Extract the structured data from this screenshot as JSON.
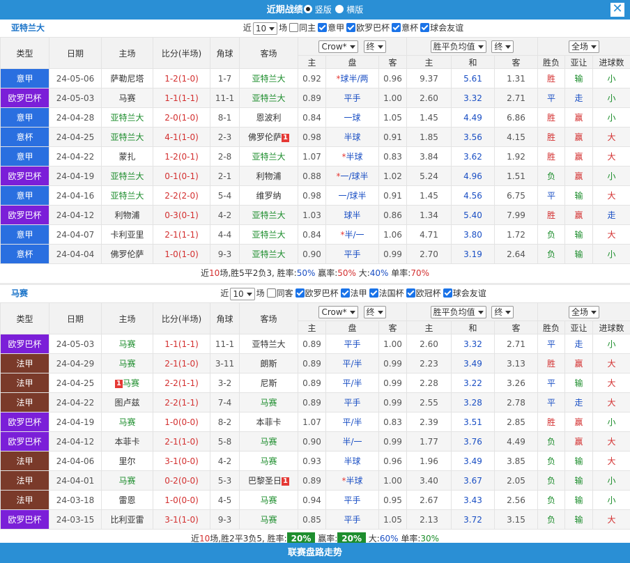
{
  "top": {
    "title": "近期战绩",
    "opt_vertical": "竖版",
    "opt_horizontal": "横版",
    "close": "✕"
  },
  "header_labels": {
    "type": "类型",
    "date": "日期",
    "home": "主场",
    "score": "比分(半场)",
    "corner": "角球",
    "away": "客场",
    "h_home": "主",
    "h_line": "盘",
    "h_away": "客",
    "o_home": "主",
    "o_draw": "和",
    "o_away": "客",
    "result": "胜负",
    "asian": "亚让",
    "goals": "进球数"
  },
  "sections": [
    {
      "team": "亚特兰大",
      "filter": {
        "near": "近",
        "count": "10",
        "unit": "场",
        "same": "同主",
        "leagues": [
          "意甲",
          "欧罗巴杯",
          "意杯",
          "球会友谊"
        ],
        "company": "Crow*",
        "phase1": "终",
        "oddtype": "胜平负均值",
        "phase2": "终",
        "half": "全场"
      },
      "rows": [
        {
          "type": "意甲",
          "tc": "ita",
          "date": "24-05-06",
          "home": "萨勒尼塔",
          "score": "1-2(1-0)",
          "corner": "1-7",
          "away": "亚特兰大",
          "hl": "away",
          "hh": "0.92",
          "hline": "*球半/两",
          "ha": "0.96",
          "oh": "9.37",
          "od": "5.61",
          "oa": "1.31",
          "res": "胜",
          "asian": "输",
          "goals": "小"
        },
        {
          "type": "欧罗巴杯",
          "tc": "cup",
          "date": "24-05-03",
          "home": "马赛",
          "score": "1-1(1-1)",
          "corner": "11-1",
          "away": "亚特兰大",
          "hl": "away",
          "hh": "0.89",
          "hline": "平手",
          "ha": "1.00",
          "oh": "2.60",
          "od": "3.32",
          "oa": "2.71",
          "res": "平",
          "asian": "走",
          "goals": "小"
        },
        {
          "type": "意甲",
          "tc": "ita",
          "date": "24-04-28",
          "home": "亚特兰大",
          "score": "2-0(1-0)",
          "corner": "8-1",
          "away": "恩波利",
          "hl": "home",
          "hh": "0.84",
          "hline": "一球",
          "ha": "1.05",
          "oh": "1.45",
          "od": "4.49",
          "oa": "6.86",
          "res": "胜",
          "asian": "赢",
          "goals": "小"
        },
        {
          "type": "意杯",
          "tc": "ita",
          "date": "24-04-25",
          "home": "亚特兰大",
          "score": "4-1(1-0)",
          "corner": "2-3",
          "away": "佛罗伦萨",
          "awayred": "1",
          "hl": "home",
          "hh": "0.98",
          "hline": "半球",
          "ha": "0.91",
          "oh": "1.85",
          "od": "3.56",
          "oa": "4.15",
          "res": "胜",
          "asian": "赢",
          "goals": "大"
        },
        {
          "type": "意甲",
          "tc": "ita",
          "date": "24-04-22",
          "home": "蒙扎",
          "score": "1-2(0-1)",
          "corner": "2-8",
          "away": "亚特兰大",
          "hl": "away",
          "hh": "1.07",
          "hline": "*半球",
          "ha": "0.83",
          "oh": "3.84",
          "od": "3.62",
          "oa": "1.92",
          "res": "胜",
          "asian": "赢",
          "goals": "大"
        },
        {
          "type": "欧罗巴杯",
          "tc": "cup",
          "date": "24-04-19",
          "home": "亚特兰大",
          "score": "0-1(0-1)",
          "corner": "2-1",
          "away": "利物浦",
          "hl": "home",
          "hh": "0.88",
          "hline": "*一/球半",
          "ha": "1.02",
          "oh": "5.24",
          "od": "4.96",
          "oa": "1.51",
          "res": "负",
          "asian": "赢",
          "goals": "小"
        },
        {
          "type": "意甲",
          "tc": "ita",
          "date": "24-04-16",
          "home": "亚特兰大",
          "score": "2-2(2-0)",
          "corner": "5-4",
          "away": "维罗纳",
          "hl": "home",
          "hh": "0.98",
          "hline": "一/球半",
          "ha": "0.91",
          "oh": "1.45",
          "od": "4.56",
          "oa": "6.75",
          "res": "平",
          "asian": "输",
          "goals": "大"
        },
        {
          "type": "欧罗巴杯",
          "tc": "cup",
          "date": "24-04-12",
          "home": "利物浦",
          "score": "0-3(0-1)",
          "corner": "4-2",
          "away": "亚特兰大",
          "hl": "away",
          "hh": "1.03",
          "hline": "球半",
          "ha": "0.86",
          "oh": "1.34",
          "od": "5.40",
          "oa": "7.99",
          "res": "胜",
          "asian": "赢",
          "goals": "走"
        },
        {
          "type": "意甲",
          "tc": "ita",
          "date": "24-04-07",
          "home": "卡利亚里",
          "score": "2-1(1-1)",
          "corner": "4-4",
          "away": "亚特兰大",
          "hl": "away",
          "hh": "0.84",
          "hline": "*半/一",
          "ha": "1.06",
          "oh": "4.71",
          "od": "3.80",
          "oa": "1.72",
          "res": "负",
          "asian": "输",
          "goals": "大"
        },
        {
          "type": "意杯",
          "tc": "ita",
          "date": "24-04-04",
          "home": "佛罗伦萨",
          "score": "1-0(1-0)",
          "corner": "9-3",
          "away": "亚特兰大",
          "hl": "away",
          "hh": "0.90",
          "hline": "平手",
          "ha": "0.99",
          "oh": "2.70",
          "od": "3.19",
          "oa": "2.64",
          "res": "负",
          "asian": "输",
          "goals": "小"
        }
      ],
      "summary": {
        "p1": "近",
        "n": "10",
        "p2": "场,胜5平2负3, 胜率:",
        "win": "50%",
        "p3": " 赢率:",
        "ying": "50%",
        "p4": " 大:",
        "big": "40%",
        "p5": " 单率:",
        "odd": "70%"
      }
    },
    {
      "team": "马赛",
      "filter": {
        "near": "近",
        "count": "10",
        "unit": "场",
        "same": "同客",
        "leagues": [
          "欧罗巴杯",
          "法甲",
          "法国杯",
          "欧冠杯",
          "球会友谊"
        ],
        "company": "Crow*",
        "phase1": "终",
        "oddtype": "胜平负均值",
        "phase2": "终",
        "half": "全场"
      },
      "rows": [
        {
          "type": "欧罗巴杯",
          "tc": "cup",
          "date": "24-05-03",
          "home": "马赛",
          "score": "1-1(1-1)",
          "corner": "11-1",
          "away": "亚特兰大",
          "hl": "home",
          "hh": "0.89",
          "hline": "平手",
          "ha": "1.00",
          "oh": "2.60",
          "od": "3.32",
          "oa": "2.71",
          "res": "平",
          "asian": "走",
          "goals": "小"
        },
        {
          "type": "法甲",
          "tc": "fra",
          "date": "24-04-29",
          "home": "马赛",
          "score": "2-1(1-0)",
          "corner": "3-11",
          "away": "朗斯",
          "hl": "home",
          "hh": "0.89",
          "hline": "平/半",
          "ha": "0.99",
          "oh": "2.23",
          "od": "3.49",
          "oa": "3.13",
          "res": "胜",
          "asian": "赢",
          "goals": "大"
        },
        {
          "type": "法甲",
          "tc": "fra",
          "date": "24-04-25",
          "home": "马赛",
          "homered": "1",
          "score": "2-2(1-1)",
          "corner": "3-2",
          "away": "尼斯",
          "hl": "home",
          "hh": "0.89",
          "hline": "平/半",
          "ha": "0.99",
          "oh": "2.28",
          "od": "3.22",
          "oa": "3.26",
          "res": "平",
          "asian": "输",
          "goals": "大"
        },
        {
          "type": "法甲",
          "tc": "fra",
          "date": "24-04-22",
          "home": "图卢兹",
          "score": "2-2(1-1)",
          "corner": "7-4",
          "away": "马赛",
          "hl": "away",
          "hh": "0.89",
          "hline": "平手",
          "ha": "0.99",
          "oh": "2.55",
          "od": "3.28",
          "oa": "2.78",
          "res": "平",
          "asian": "走",
          "goals": "大"
        },
        {
          "type": "欧罗巴杯",
          "tc": "cup",
          "date": "24-04-19",
          "home": "马赛",
          "score": "1-0(0-0)",
          "corner": "8-2",
          "away": "本菲卡",
          "hl": "home",
          "hh": "1.07",
          "hline": "平/半",
          "ha": "0.83",
          "oh": "2.39",
          "od": "3.51",
          "oa": "2.85",
          "res": "胜",
          "asian": "赢",
          "goals": "小"
        },
        {
          "type": "欧罗巴杯",
          "tc": "cup",
          "date": "24-04-12",
          "home": "本菲卡",
          "score": "2-1(1-0)",
          "corner": "5-8",
          "away": "马赛",
          "hl": "away",
          "hh": "0.90",
          "hline": "半/一",
          "ha": "0.99",
          "oh": "1.77",
          "od": "3.76",
          "oa": "4.49",
          "res": "负",
          "asian": "赢",
          "goals": "大"
        },
        {
          "type": "法甲",
          "tc": "fra",
          "date": "24-04-06",
          "home": "里尔",
          "score": "3-1(0-0)",
          "corner": "4-2",
          "away": "马赛",
          "hl": "away",
          "hh": "0.93",
          "hline": "半球",
          "ha": "0.96",
          "oh": "1.96",
          "od": "3.49",
          "oa": "3.85",
          "res": "负",
          "asian": "输",
          "goals": "大"
        },
        {
          "type": "法甲",
          "tc": "fra",
          "date": "24-04-01",
          "home": "马赛",
          "score": "0-2(0-0)",
          "corner": "5-3",
          "away": "巴黎圣日",
          "awayred": "1",
          "hl": "home",
          "hh": "0.89",
          "hline": "*半球",
          "ha": "1.00",
          "oh": "3.40",
          "od": "3.67",
          "oa": "2.05",
          "res": "负",
          "asian": "输",
          "goals": "小"
        },
        {
          "type": "法甲",
          "tc": "fra",
          "date": "24-03-18",
          "home": "雷恩",
          "score": "1-0(0-0)",
          "corner": "4-5",
          "away": "马赛",
          "hl": "away",
          "hh": "0.94",
          "hline": "平手",
          "ha": "0.95",
          "oh": "2.67",
          "od": "3.43",
          "oa": "2.56",
          "res": "负",
          "asian": "输",
          "goals": "小"
        },
        {
          "type": "欧罗巴杯",
          "tc": "cup",
          "date": "24-03-15",
          "home": "比利亚雷",
          "score": "3-1(1-0)",
          "corner": "9-3",
          "away": "马赛",
          "hl": "away",
          "hh": "0.85",
          "hline": "平手",
          "ha": "1.05",
          "oh": "2.13",
          "od": "3.72",
          "oa": "3.15",
          "res": "负",
          "asian": "输",
          "goals": "大"
        }
      ],
      "summary": {
        "p1": "近",
        "n": "10",
        "p2": "场,胜2平3负5, 胜率:",
        "win": "20%",
        "p3": " 赢率:",
        "ying": "20%",
        "p4": " 大:",
        "big": "60%",
        "p5": " 单率:",
        "odd": "30%"
      }
    }
  ],
  "bottom": {
    "title": "联赛盘路走势"
  }
}
